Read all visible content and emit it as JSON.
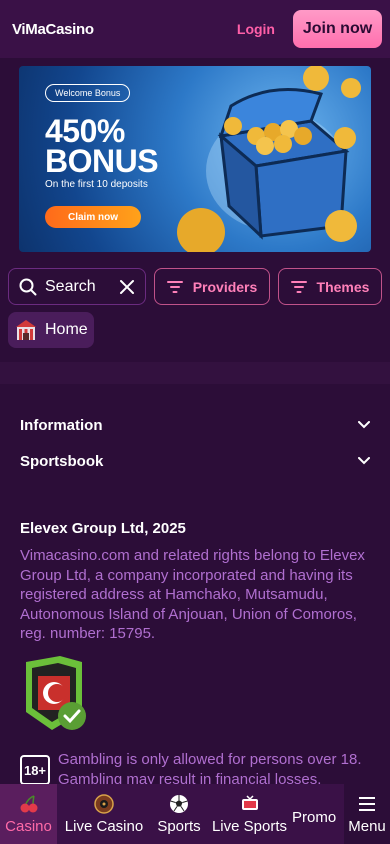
{
  "header": {
    "logo": "ViMaCasino",
    "login_label": "Login",
    "join_label": "Join now"
  },
  "banner": {
    "badge": "Welcome Bonus",
    "headline_line1": "450%",
    "headline_line2": "BONUS",
    "subline": "On the first 10 deposits",
    "cta": "Claim now"
  },
  "filters": {
    "search_label": "Search",
    "providers_label": "Providers",
    "themes_label": "Themes"
  },
  "home_chip": {
    "label": "Home"
  },
  "footer": {
    "sections": [
      {
        "label": "Information"
      },
      {
        "label": "Sportsbook"
      }
    ],
    "company_title": "Elevex Group Ltd, 2025",
    "company_text": "Vimacasino.com and related rights belong to Elevex Group Ltd, a company incorporated and having its registered address at Hamchako, Mutsamudu, Autonomous Island of Anjouan, Union of Comoros, reg. number: 15795.",
    "age_badge": "18+",
    "gambling_notice": "Gambling is only allowed for persons over 18. Gambling may result in financial losses."
  },
  "bottom_nav": {
    "items": [
      {
        "label": "Casino",
        "icon": "cherry-icon",
        "active": true
      },
      {
        "label": "Live Casino",
        "icon": "roulette-icon",
        "active": false
      },
      {
        "label": "Sports",
        "icon": "soccer-ball-icon",
        "active": false
      },
      {
        "label": "Live Sports",
        "icon": "live-tv-icon",
        "active": false
      },
      {
        "label": "Promo",
        "icon": "",
        "active": false
      },
      {
        "label": "Menu",
        "icon": "hamburger-icon",
        "active": false
      }
    ]
  },
  "colors": {
    "background": "#2c0d38",
    "header": "#3a1147",
    "accent_pink": "#ff6aa8",
    "muted_text": "#b06fd0"
  }
}
